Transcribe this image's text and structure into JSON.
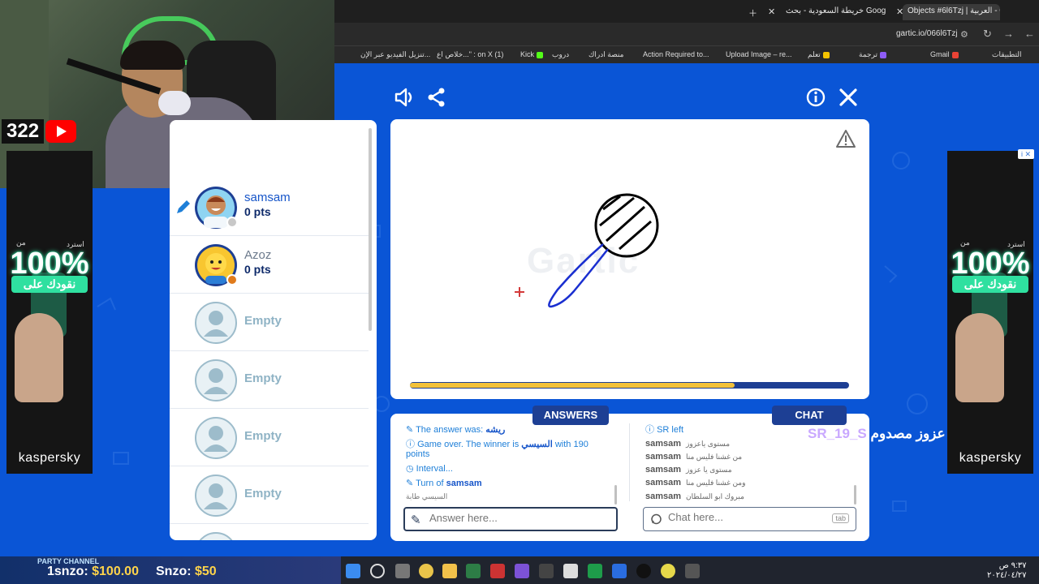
{
  "browser": {
    "tabs": [
      {
        "title": "Objects #6l6Tzj | العربية - Gartic",
        "active": true
      },
      {
        "title": "خريطة السعودية - بحث Google",
        "active": false
      }
    ],
    "url": "gartic.io/066l6Tzj",
    "bookmarks": [
      "التطبيقات",
      "Gmail",
      "ترجمة",
      "تعلم",
      "Upload Image – re...",
      "Action Required to...",
      "منصة ادراك",
      "دروب",
      "Kick",
      "خلاص اع...\" : on X (1)",
      "تنزيل الفيديو عبر الإن..."
    ]
  },
  "stream": {
    "viewer_count": "322"
  },
  "ads": {
    "left": {
      "top_text": "استرد",
      "top_text2": "من",
      "big": "100%",
      "sub": "نقودك على",
      "brand": "kaspersky"
    },
    "right": {
      "top_text": "استرد",
      "top_text2": "من",
      "big": "100%",
      "sub": "نقودك على",
      "brand": "kaspersky"
    }
  },
  "players": [
    {
      "name": "samsam",
      "points": "0 pts",
      "drawing": true,
      "status_color": "#c8c8c8"
    },
    {
      "name": "Azoz",
      "points": "0 pts",
      "drawing": false,
      "status_color": "#e07b1c"
    },
    {
      "name": "Empty"
    },
    {
      "name": "Empty"
    },
    {
      "name": "Empty"
    },
    {
      "name": "Empty"
    }
  ],
  "canvas": {
    "watermark": "Gartic",
    "timer_remaining_fraction": 0.74
  },
  "answers_panel": {
    "title": "ANSWERS",
    "lines": [
      {
        "prefix": "The answer was: ",
        "highlight": "ريشه"
      },
      {
        "prefix": "Game over. The winner is ",
        "highlight": "السيسي",
        "suffix": " with 190 points"
      },
      {
        "prefix": "Interval..."
      },
      {
        "prefix": "Turn of ",
        "highlight": "samsam"
      },
      {
        "prefix": "السيسي طابة"
      }
    ],
    "input_placeholder": "Answer here..."
  },
  "chat_panel": {
    "title": "CHAT",
    "system_line": "SR left",
    "messages": [
      {
        "user": "samsam",
        "text": "مستوى ياعزوز"
      },
      {
        "user": "samsam",
        "text": "من غشنا فليس منا"
      },
      {
        "user": "samsam",
        "text": "مستوى يا عزوز"
      },
      {
        "user": "samsam",
        "text": "ومن غشنا فليس منا"
      },
      {
        "user": "samsam",
        "text": "مبروك ابو السلطان"
      }
    ],
    "input_placeholder": "Chat here...",
    "tab_hint": "tab"
  },
  "overlay": {
    "name_tag": "SR_19_S",
    "name_text": "عزوز مصدوم"
  },
  "donations": {
    "banner": "PARTY CHANNEL",
    "items": [
      {
        "user": "1snzo:",
        "amount": "$100.00"
      },
      {
        "user": "Snzo:",
        "amount": "$50"
      }
    ]
  },
  "taskbar": {
    "clock_time": "٩:٣٧ ص",
    "clock_date": "٢٠٢٤/٠٤/٢٧"
  },
  "colors": {
    "brand_blue": "#0a55d6",
    "dark_blue": "#1d3f94",
    "timer_yellow": "#f2c13a",
    "stroke_blue": "#1a2fd0"
  }
}
